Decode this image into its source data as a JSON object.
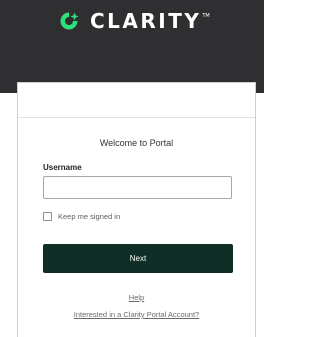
{
  "header": {
    "brand_name": "CLARITY",
    "trademark": "TM",
    "brand_color": "#2fe07a",
    "background_color": "#2f2f31"
  },
  "login": {
    "welcome_text": "Welcome to Portal",
    "username_label": "Username",
    "username_value": "",
    "remember_label": "Keep me signed in",
    "remember_checked": false,
    "next_label": "Next",
    "button_color": "#0f2f26"
  },
  "links": {
    "help": "Help",
    "account": "Interested in a Clarity Portal Account?"
  }
}
